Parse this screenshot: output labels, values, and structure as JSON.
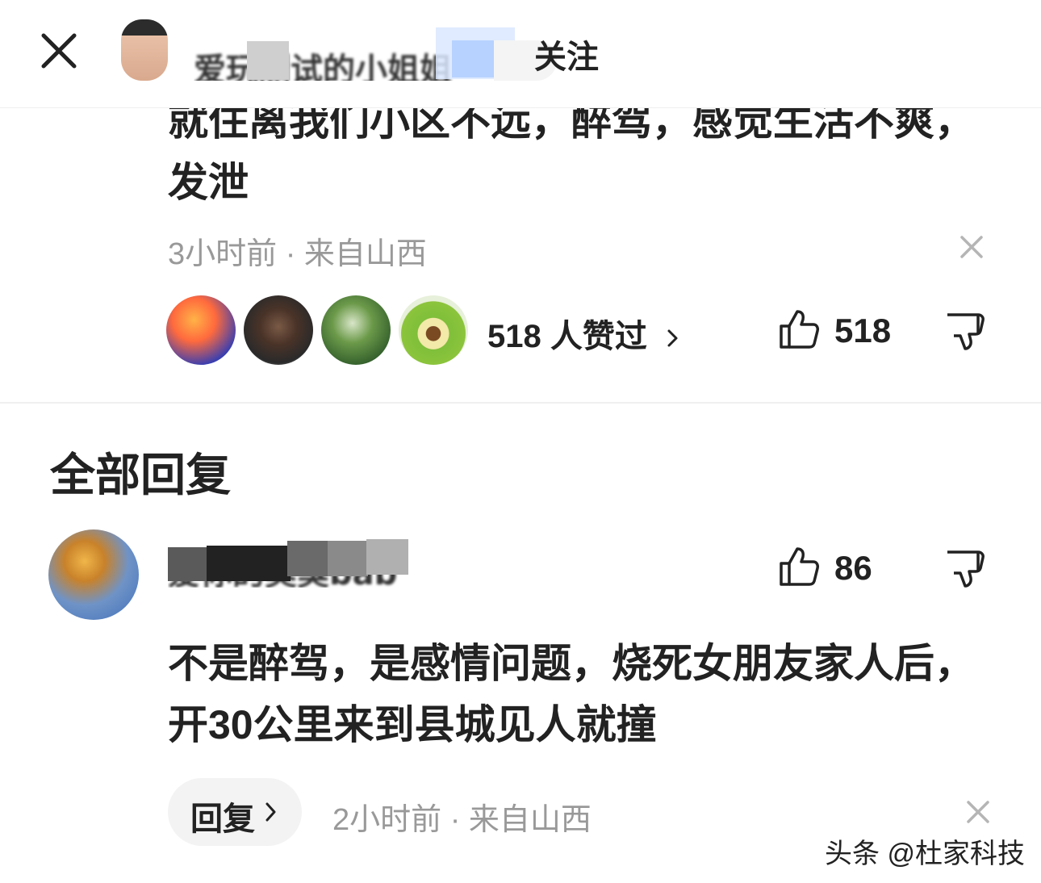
{
  "header": {
    "username": "爱玩测试的小姐姐",
    "follow_label": "关注"
  },
  "comment": {
    "text": "就住离我们小区不远，醉驾，感觉生活不爽，发泄",
    "time": "3小时前",
    "location": "来自山西",
    "liked_by_label": "518 人赞过",
    "like_count": "518"
  },
  "replies": {
    "section_title": "全部回复",
    "items": [
      {
        "username": "爱你的臭臭bab",
        "like_count": "86",
        "text": "不是醉驾，是感情问题，烧死女朋友家人后，开30公里来到县城见人就撞",
        "reply_label": "回复",
        "time": "2小时前",
        "location": "来自山西"
      }
    ]
  },
  "watermark": "头条 @杜家科技",
  "colors": {
    "text_primary": "#222222",
    "text_secondary": "#999999",
    "reply_pill_bg": "#f3f3f3",
    "divider": "#f0f0f0"
  },
  "icons": {
    "close": "close-icon",
    "like": "thumbs-up-icon",
    "dislike": "thumbs-down-icon",
    "dismiss": "x-icon",
    "chevron": "chevron-right-icon"
  }
}
